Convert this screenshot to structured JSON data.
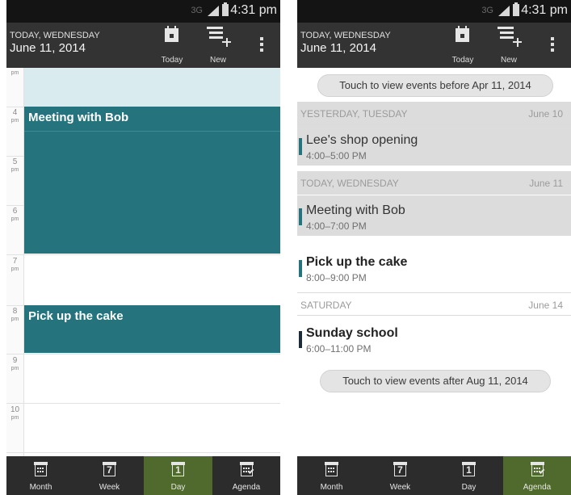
{
  "status_bar": {
    "network": "3G",
    "time": "4:31 pm"
  },
  "header": {
    "day_label": "TODAY, WEDNESDAY",
    "date": "June 11, 2014",
    "today_label": "Today",
    "new_label": "New"
  },
  "day_view": {
    "top_label_ampm": "pm",
    "hours": [
      {
        "hour": "4",
        "ampm": "pm"
      },
      {
        "hour": "5",
        "ampm": "pm"
      },
      {
        "hour": "6",
        "ampm": "pm"
      },
      {
        "hour": "7",
        "ampm": "pm"
      },
      {
        "hour": "8",
        "ampm": "pm"
      },
      {
        "hour": "9",
        "ampm": "pm"
      },
      {
        "hour": "10",
        "ampm": "pm"
      }
    ],
    "events": [
      {
        "title": "Meeting with Bob"
      },
      {
        "title": "Pick up the cake"
      }
    ]
  },
  "agenda": {
    "before_button": "Touch to view events before Apr 11, 2014",
    "after_button": "Touch to view events after Aug 11, 2014",
    "sections": [
      {
        "day": "YESTERDAY, TUESDAY",
        "date": "June 10"
      },
      {
        "day": "TODAY, WEDNESDAY",
        "date": "June 11"
      },
      {
        "day": "SATURDAY",
        "date": "June 14"
      }
    ],
    "items": [
      {
        "title": "Lee's shop opening",
        "time": "4:00–5:00 PM"
      },
      {
        "title": "Meeting with Bob",
        "time": "4:00–7:00 PM"
      },
      {
        "title": "Pick up the cake",
        "time": "8:00–9:00 PM"
      },
      {
        "title": "Sunday school",
        "time": "6:00–11:00 PM"
      }
    ]
  },
  "bottom_nav": {
    "month": "Month",
    "week": "Week",
    "day": "Day",
    "agenda": "Agenda",
    "week_icon_digit": "7",
    "day_icon_digit": "1"
  },
  "colors": {
    "event_teal": "#25737c",
    "nav_active": "#4f6a2c",
    "action_bar": "#333333"
  }
}
